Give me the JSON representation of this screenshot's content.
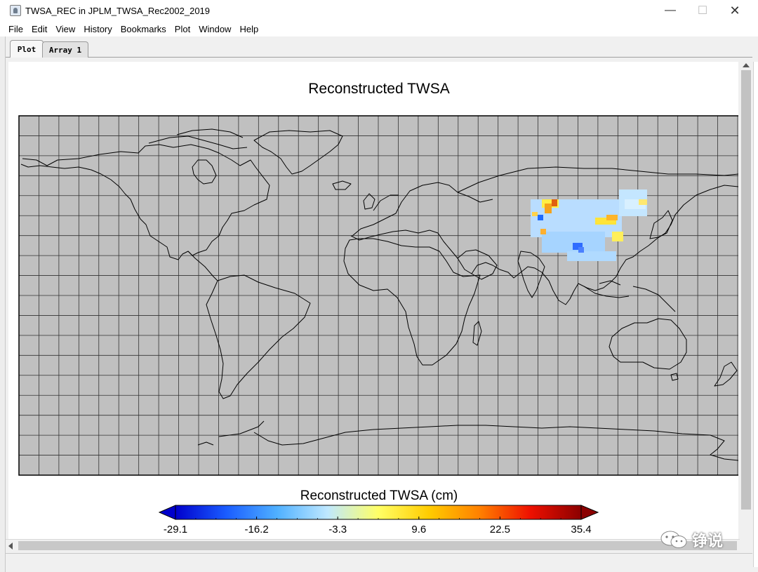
{
  "window": {
    "title": "TWSA_REC in JPLM_TWSA_Rec2002_2019",
    "minimize": "—",
    "maximize": "☐",
    "close": "✕"
  },
  "menu": [
    "File",
    "Edit",
    "View",
    "History",
    "Bookmarks",
    "Plot",
    "Window",
    "Help"
  ],
  "tabs": [
    {
      "label": "Plot",
      "active": true
    },
    {
      "label": "Array 1",
      "active": false
    }
  ],
  "plot": {
    "title": "Reconstructed TWSA",
    "background": "#c0c0c0",
    "grid_on": true,
    "meridians_deg": [
      -180,
      -170,
      -160,
      -150,
      -140,
      -130,
      -120,
      -110,
      -100,
      -90,
      -80,
      -70,
      -60,
      -50,
      -40,
      -30,
      -20,
      -10,
      0,
      10,
      20,
      30,
      40,
      50,
      60,
      70,
      80,
      90,
      100,
      110,
      120,
      130,
      140,
      150,
      160,
      170,
      180
    ],
    "parallels_deg": [
      80,
      70,
      60,
      50,
      40,
      30,
      20,
      10,
      0,
      -10,
      -20,
      -30,
      -40,
      -50,
      -60,
      -70,
      -80
    ],
    "projection": "equirectangular, longitude -180 to 180, latitude -90 to 90"
  },
  "colorbar": {
    "label": "Reconstructed TWSA (cm)",
    "min": -29.1,
    "max": 35.4,
    "tick_labels": [
      "-29.1",
      "-16.2",
      "-3.3",
      "9.6",
      "22.5",
      "35.4"
    ],
    "stops": [
      "#0000cc",
      "#1a5cff",
      "#4fb0ff",
      "#bfe8ff",
      "#ffff66",
      "#ffcc00",
      "#ff8000",
      "#ee1000",
      "#8b0000"
    ],
    "extend_low_color": "#0000cc",
    "extend_high_color": "#8b0000"
  },
  "watermark": {
    "text": "铮说"
  }
}
